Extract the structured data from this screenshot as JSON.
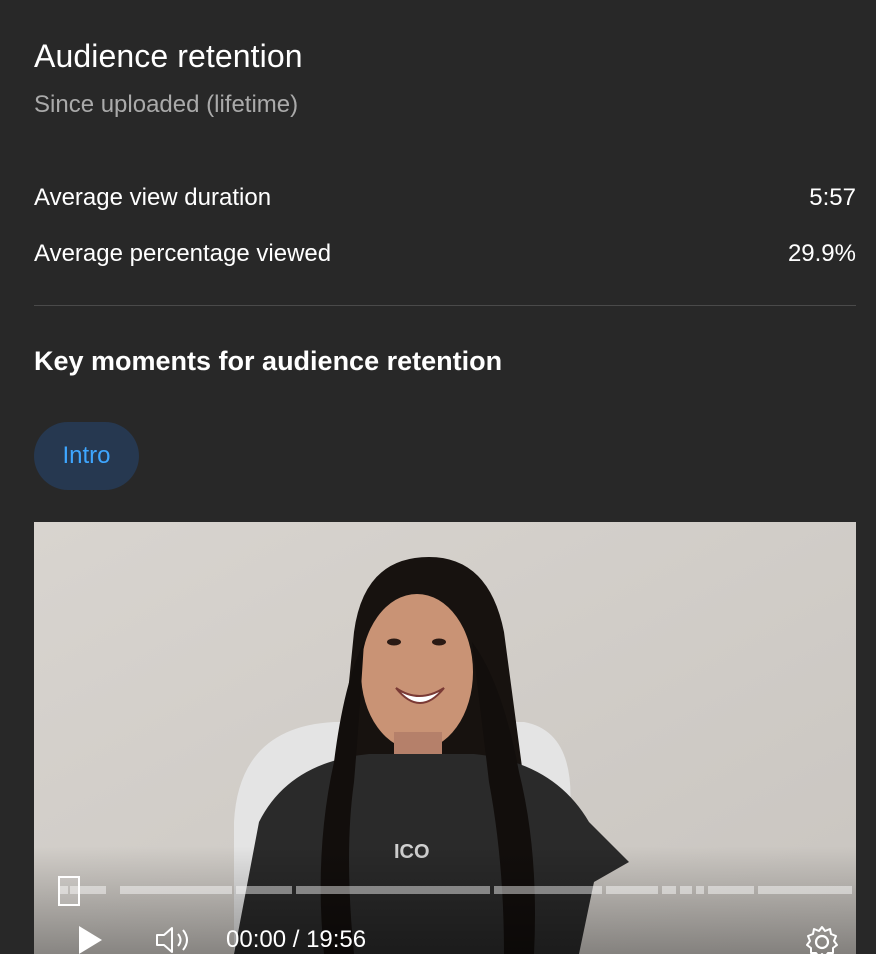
{
  "header": {
    "title": "Audience retention",
    "subtitle": "Since uploaded (lifetime)"
  },
  "metrics": [
    {
      "label": "Average view duration",
      "value": "5:57"
    },
    {
      "label": "Average percentage viewed",
      "value": "29.9%"
    }
  ],
  "key_moments": {
    "title": "Key moments for audience retention",
    "chip_label": "Intro"
  },
  "player": {
    "time_display": "00:00 / 19:56",
    "icons": [
      "play-icon",
      "volume-icon",
      "settings-gear-icon"
    ],
    "progress_fraction": 0.0
  },
  "colors": {
    "background": "#282828",
    "chip_background": "#263850",
    "chip_text": "#3ea6ff",
    "secondary_text": "#aaaaaa",
    "divider": "#4a4a4a"
  }
}
